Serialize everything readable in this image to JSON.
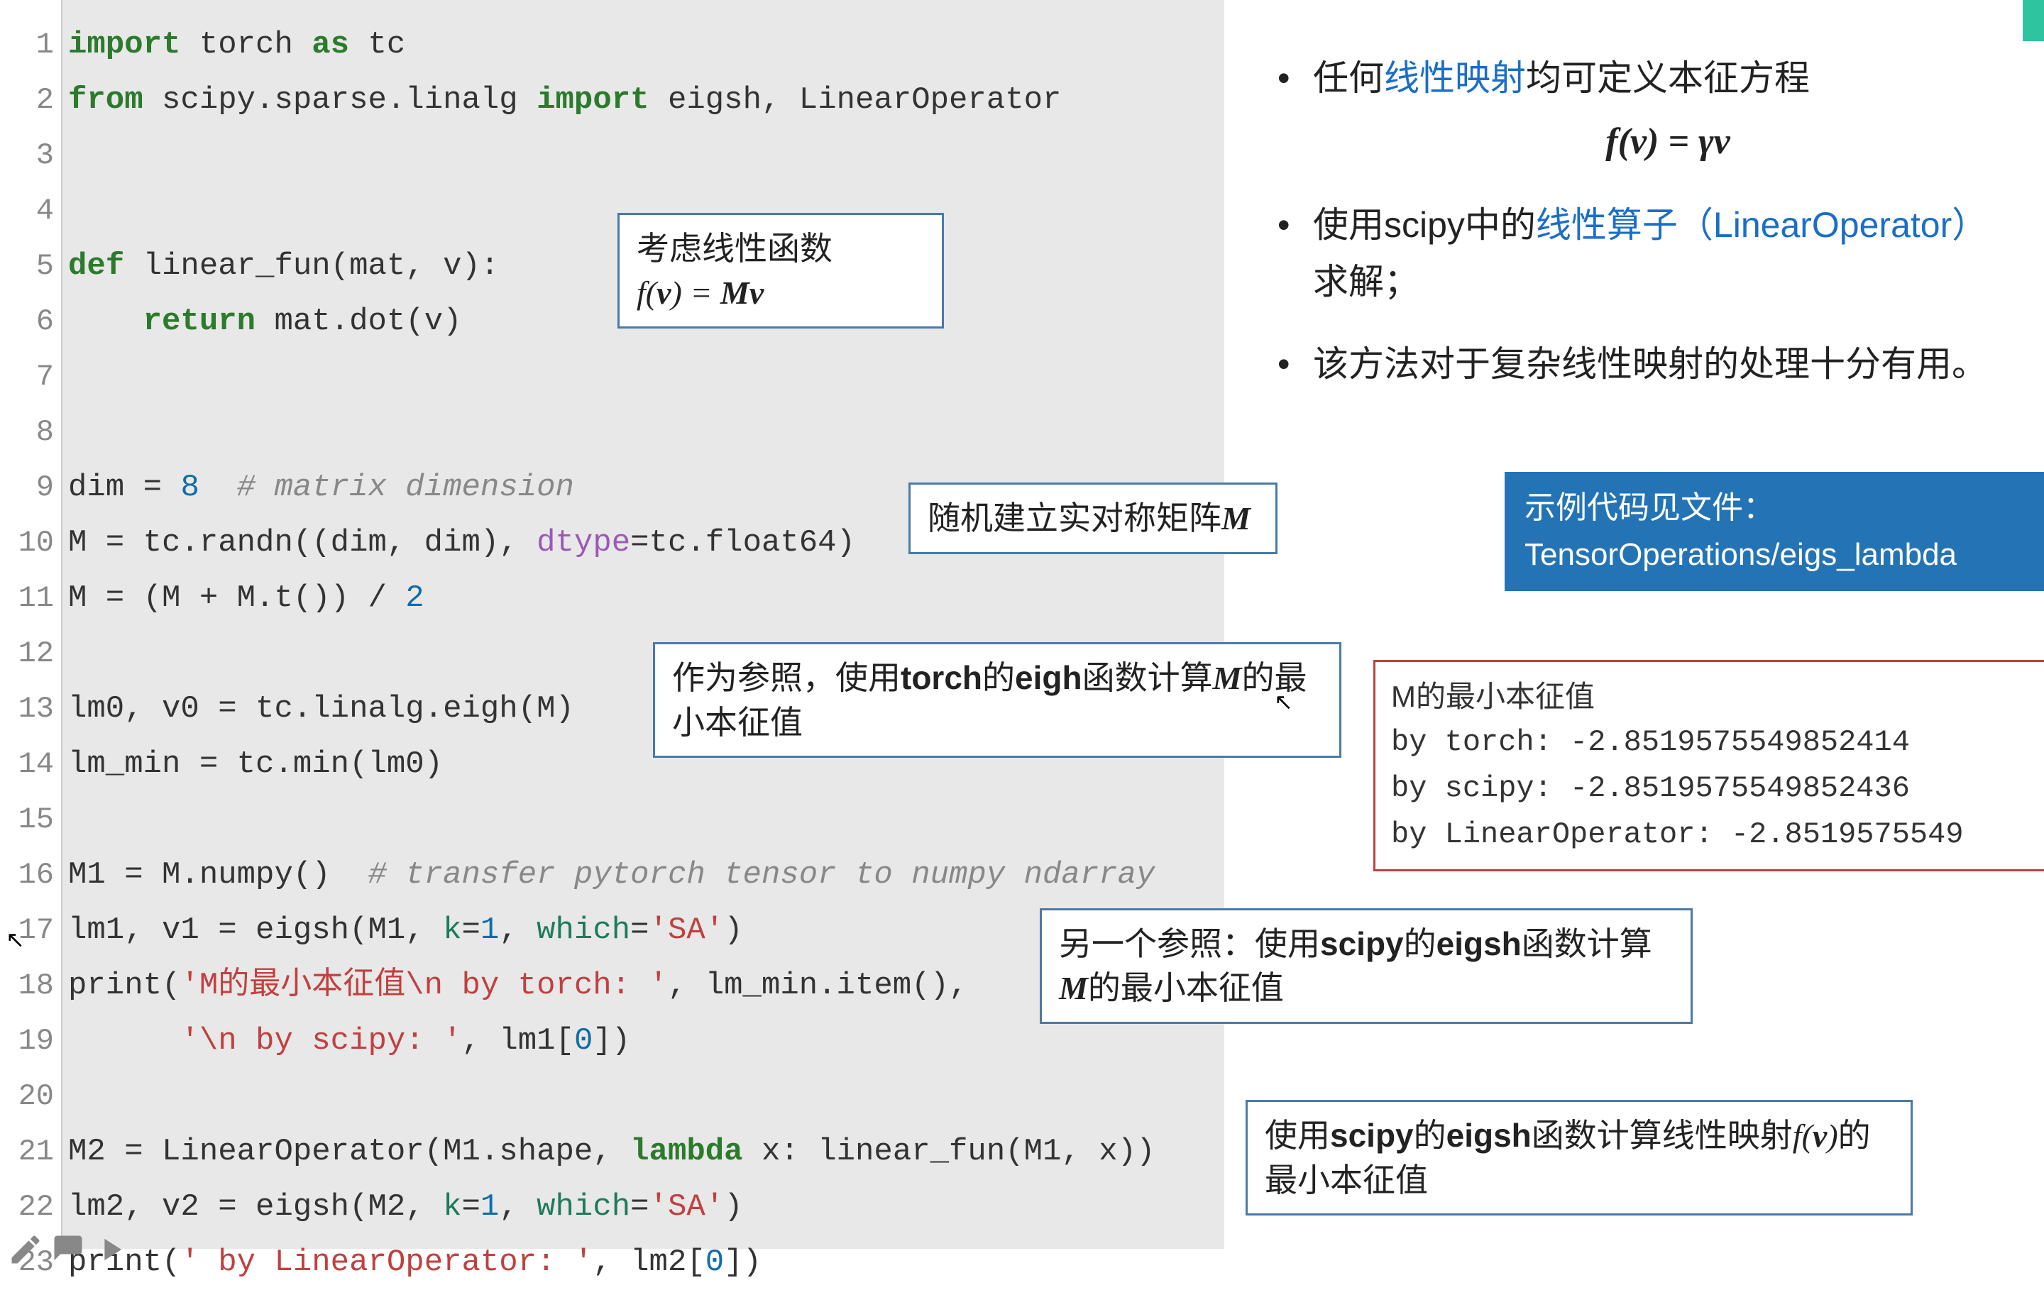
{
  "code": {
    "lines": [
      {
        "n": "1",
        "seg": [
          [
            "kw",
            "import"
          ],
          [
            "var",
            " torch "
          ],
          [
            "kw",
            "as"
          ],
          [
            "var",
            " tc"
          ]
        ]
      },
      {
        "n": "2",
        "seg": [
          [
            "kw",
            "from"
          ],
          [
            "var",
            " scipy.sparse.linalg "
          ],
          [
            "kw",
            "import"
          ],
          [
            "var",
            " eigsh, LinearOperator"
          ]
        ]
      },
      {
        "n": "3",
        "seg": []
      },
      {
        "n": "4",
        "seg": []
      },
      {
        "n": "5",
        "seg": [
          [
            "kw",
            "def"
          ],
          [
            "var",
            " linear_fun(mat, v):"
          ]
        ]
      },
      {
        "n": "6",
        "seg": [
          [
            "var",
            "    "
          ],
          [
            "kw",
            "return"
          ],
          [
            "var",
            " mat.dot(v)"
          ]
        ]
      },
      {
        "n": "7",
        "seg": []
      },
      {
        "n": "8",
        "seg": []
      },
      {
        "n": "9",
        "seg": [
          [
            "var",
            "dim = "
          ],
          [
            "num",
            "8"
          ],
          [
            "var",
            "  "
          ],
          [
            "cmt",
            "# matrix dimension"
          ]
        ]
      },
      {
        "n": "10",
        "seg": [
          [
            "var",
            "M = tc.randn((dim, dim), "
          ],
          [
            "highlight-type",
            "dtype"
          ],
          [
            "var",
            "=tc.float64)"
          ]
        ]
      },
      {
        "n": "11",
        "seg": [
          [
            "var",
            "M = (M + M.t()) / "
          ],
          [
            "num",
            "2"
          ]
        ]
      },
      {
        "n": "12",
        "seg": []
      },
      {
        "n": "13",
        "seg": [
          [
            "var",
            "lm0, v0 = tc.linalg.eigh(M)"
          ]
        ]
      },
      {
        "n": "14",
        "seg": [
          [
            "var",
            "lm_min = tc.min(lm0)"
          ]
        ]
      },
      {
        "n": "15",
        "seg": []
      },
      {
        "n": "16",
        "seg": [
          [
            "var",
            "M1 = M.numpy()  "
          ],
          [
            "cmt",
            "# transfer pytorch tensor to numpy ndarray"
          ]
        ]
      },
      {
        "n": "17",
        "seg": [
          [
            "var",
            "lm1, v1 = eigsh(M1, "
          ],
          [
            "param",
            "k"
          ],
          [
            "var",
            "="
          ],
          [
            "num",
            "1"
          ],
          [
            "var",
            ", "
          ],
          [
            "param",
            "which"
          ],
          [
            "var",
            "="
          ],
          [
            "str",
            "'SA'"
          ],
          [
            "var",
            ")"
          ]
        ]
      },
      {
        "n": "18",
        "seg": [
          [
            "var",
            "print("
          ],
          [
            "str",
            "'M的最小本征值\\n by torch: '"
          ],
          [
            "var",
            ", lm_min.item(),"
          ]
        ]
      },
      {
        "n": "19",
        "seg": [
          [
            "var",
            "      "
          ],
          [
            "str",
            "'\\n by scipy: '"
          ],
          [
            "var",
            ", lm1["
          ],
          [
            "num",
            "0"
          ],
          [
            "var",
            "])"
          ]
        ]
      },
      {
        "n": "20",
        "seg": []
      },
      {
        "n": "21",
        "seg": [
          [
            "var",
            "M2 = LinearOperator(M1.shape, "
          ],
          [
            "kw",
            "lambda"
          ],
          [
            "var",
            " x: linear_fun(M1, x))"
          ]
        ]
      },
      {
        "n": "22",
        "seg": [
          [
            "var",
            "lm2, v2 = eigsh(M2, "
          ],
          [
            "param",
            "k"
          ],
          [
            "var",
            "="
          ],
          [
            "num",
            "1"
          ],
          [
            "var",
            ", "
          ],
          [
            "param",
            "which"
          ],
          [
            "var",
            "="
          ],
          [
            "str",
            "'SA'"
          ],
          [
            "var",
            ")"
          ]
        ]
      },
      {
        "n": "23",
        "seg": [
          [
            "var",
            "print("
          ],
          [
            "str",
            "' by LinearOperator: '"
          ],
          [
            "var",
            ", lm2["
          ],
          [
            "num",
            "0"
          ],
          [
            "var",
            "])"
          ]
        ]
      }
    ]
  },
  "annotations": {
    "a1": {
      "pos": "left:870px;top:300px;width:460px",
      "html": "考虑线性函数<br><span class='math'>f(<b>v</b>) = <b>Mv</b></span>"
    },
    "a2": {
      "pos": "left:1280px;top:680px;width:520px",
      "html": "随机建立实对称矩阵<span class='math bold'>M</span>"
    },
    "a3": {
      "pos": "left:920px;top:905px;width:970px",
      "html": "作为参照，使用<b>torch</b>的<b>eigh</b>函数计算<span class='math bold'>M</span>的最小本征值"
    },
    "a4": {
      "pos": "left:1465px;top:1280px;width:920px",
      "html": "另一个参照：使用<b>scipy</b>的<b>eigsh</b>函数计算<span class='math bold'>M</span>的最小本征值"
    },
    "a5": {
      "pos": "left:1755px;top:1550px;width:940px",
      "html": "使用<b>scipy</b>的<b>eigsh</b>函数计算线性映射<span class='math'>f(<b>v</b>)</span>的最小本征值"
    }
  },
  "bullets": {
    "b1_pre": "任何",
    "b1_link": "线性映射",
    "b1_post": "均可定义本征方程",
    "b1_eq": "f(v) = γv",
    "b2_pre": "使用scipy中的",
    "b2_link": "线性算子（LinearOperator）",
    "b2_post": " 求解；",
    "b3": "该方法对于复杂线性映射的处理十分有用。"
  },
  "filebox": {
    "l1": "示例代码见文件：",
    "l2": "TensorOperations/eigs_lambda"
  },
  "output": {
    "title": "M的最小本征值",
    "l1": " by torch:  -2.8519575549852414",
    "l2": " by scipy:  -2.8519575549852436",
    "l3": " by LinearOperator:  -2.8519575549"
  }
}
